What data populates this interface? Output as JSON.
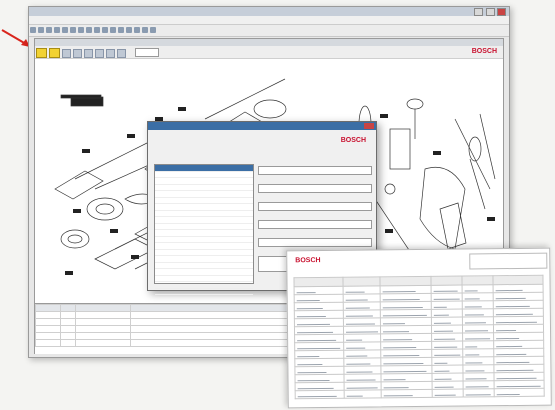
{
  "app": {
    "title": "",
    "menu": [
      "",
      "",
      "",
      "",
      ""
    ],
    "inner_title": "",
    "bosch_logo": "BOSCH",
    "drawing_label": ""
  },
  "parts_table": {
    "headers": [
      "",
      "",
      "",
      "",
      "",
      "",
      ""
    ],
    "rows": [
      [
        "",
        "",
        "",
        "",
        "",
        "",
        ""
      ],
      [
        "",
        "",
        "",
        "",
        "",
        "",
        ""
      ],
      [
        "",
        "",
        "",
        "",
        "",
        "",
        ""
      ],
      [
        "",
        "",
        "",
        "",
        "",
        "",
        ""
      ],
      [
        "",
        "",
        "",
        "",
        "",
        "",
        ""
      ]
    ]
  },
  "dialog": {
    "title": "",
    "logo": "BOSCH",
    "list_heading": "",
    "list_items": [
      "",
      "",
      "",
      "",
      "",
      "",
      "",
      "",
      "",
      "",
      "",
      "",
      "",
      "",
      "",
      "",
      "",
      "",
      "",
      ""
    ],
    "ok_label": "",
    "cancel_label": ""
  },
  "report": {
    "logo": "BOSCH",
    "title": "",
    "columns": [
      "",
      "",
      "",
      "",
      "",
      ""
    ]
  },
  "colors": {
    "bosch_red": "#c8102e",
    "arrow_red": "#d9251d",
    "dialog_titlebar": "#3b6ea5",
    "toolbar_yellow": "#f2d233"
  }
}
